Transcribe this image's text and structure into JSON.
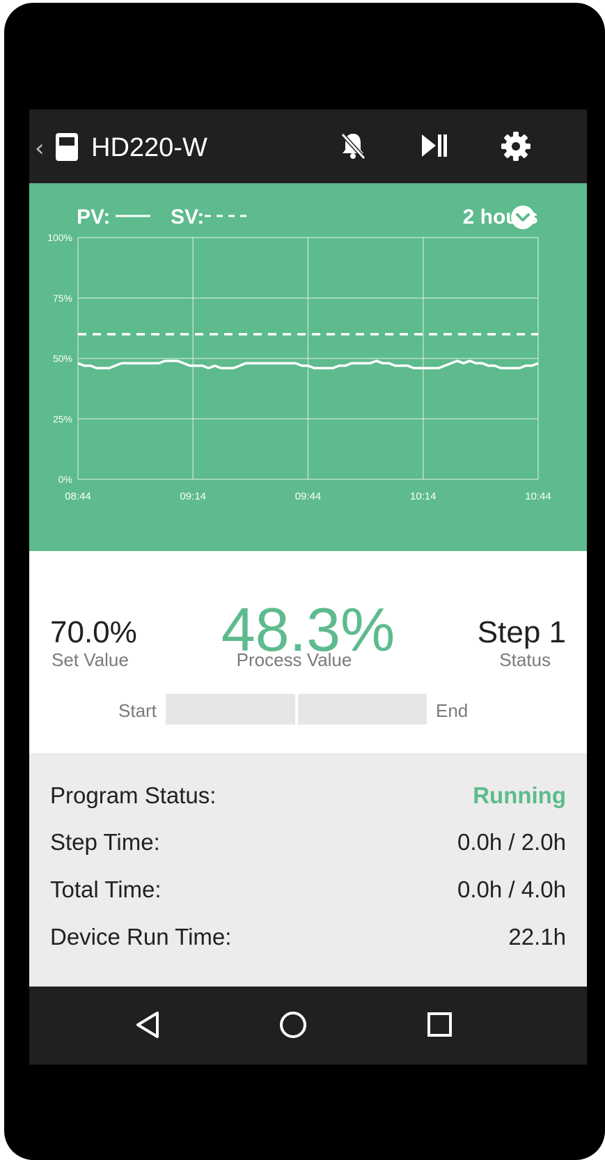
{
  "app": {
    "title": "HD220-W",
    "back_glyph": "‹",
    "icons": [
      "device-icon",
      "bell-off-icon",
      "play-pause-icon",
      "gear-icon"
    ]
  },
  "graph": {
    "pv_label": "PV:",
    "sv_label": "SV:",
    "range_label": "2 hours",
    "colors": {
      "background": "#5dbb8d",
      "line": "#ffffff"
    }
  },
  "chart_data": {
    "type": "line",
    "title": "",
    "xlabel": "",
    "ylabel": "",
    "x_ticks": [
      "08:44",
      "09:14",
      "09:44",
      "10:14",
      "10:44"
    ],
    "y_ticks": [
      "100%",
      "75%",
      "50%",
      "25%",
      "0%"
    ],
    "ylim": [
      0,
      100
    ],
    "grid": true,
    "series": [
      {
        "name": "PV",
        "style": "solid",
        "values": [
          48,
          47,
          47,
          46,
          46,
          46,
          47,
          48,
          48,
          48,
          48,
          48,
          48,
          48,
          49,
          49,
          49,
          48,
          47,
          47,
          47,
          46,
          47,
          46,
          46,
          46,
          47,
          48,
          48,
          48,
          48,
          48,
          48,
          48,
          48,
          48,
          47,
          47,
          46,
          46,
          46,
          46,
          47,
          47,
          48,
          48,
          48,
          48,
          49,
          48,
          48,
          47,
          47,
          47,
          46,
          46,
          46,
          46,
          46,
          47,
          48,
          49,
          48,
          49,
          48,
          48,
          47,
          47,
          46,
          46,
          46,
          46,
          47,
          47,
          48
        ]
      },
      {
        "name": "SV",
        "style": "dashed",
        "values": [
          60,
          60
        ]
      }
    ]
  },
  "readings": {
    "set_value": "70.0%",
    "set_label": "Set Value",
    "process_value": "48.3%",
    "process_label": "Process Value",
    "status_value": "Step 1",
    "status_label": "Status",
    "progress_start": "Start",
    "progress_end": "End",
    "progress_fraction": 0
  },
  "info": {
    "program_status_label": "Program Status:",
    "program_status_value": "Running",
    "step_time_label": "Step Time:",
    "step_time_value": "0.0h / 2.0h",
    "total_time_label": "Total Time:",
    "total_time_value": "0.0h / 4.0h",
    "run_time_label": "Device Run Time:",
    "run_time_value": "22.1h"
  },
  "nav": {
    "icons": [
      "back-icon",
      "home-icon",
      "recents-icon"
    ]
  }
}
